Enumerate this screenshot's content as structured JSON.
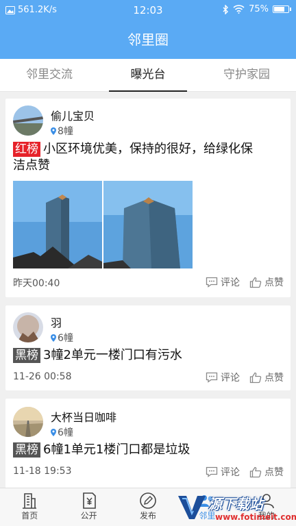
{
  "status_bar": {
    "network_speed": "561.2K/s",
    "time": "12:03",
    "battery": "75%",
    "battery_level": 0.75
  },
  "header": {
    "title": "邻里圈"
  },
  "tabs": [
    {
      "label": "邻里交流",
      "active": false
    },
    {
      "label": "曝光台",
      "active": true
    },
    {
      "label": "守护家园",
      "active": false
    }
  ],
  "posts": [
    {
      "user": "偷儿宝贝",
      "location": "8幢",
      "tag": "红榜",
      "tag_type": "red",
      "text_line1": "小区环境优美，保持的很好，给绿化保",
      "text_line2": "洁点赞",
      "time": "昨天00:40",
      "comment_label": "评论",
      "like_label": "点赞"
    },
    {
      "user": "羽",
      "location": "6幢",
      "tag": "黑榜",
      "tag_type": "black",
      "text_line1": "3幢2单元一楼门口有污水",
      "time": "11-26 00:58",
      "comment_label": "评论",
      "like_label": "点赞"
    },
    {
      "user": "大杯当日咖啡",
      "location": "6幢",
      "tag": "黑榜",
      "tag_type": "black",
      "text_line1": "6幢1单元1楼门口都是垃圾",
      "time": "11-18 19:53",
      "comment_label": "评论",
      "like_label": "点赞"
    }
  ],
  "bottom_nav": [
    {
      "label": "首页",
      "icon": "building-icon"
    },
    {
      "label": "公开",
      "icon": "document-yen-icon"
    },
    {
      "label": "发布",
      "icon": "pen-icon"
    },
    {
      "label": "邻里",
      "icon": "neighbors-icon",
      "active": true
    },
    {
      "label": "我的",
      "icon": "profile-icon"
    }
  ],
  "watermark": {
    "main": "源下载站",
    "url": "www.fotimeit.com"
  }
}
